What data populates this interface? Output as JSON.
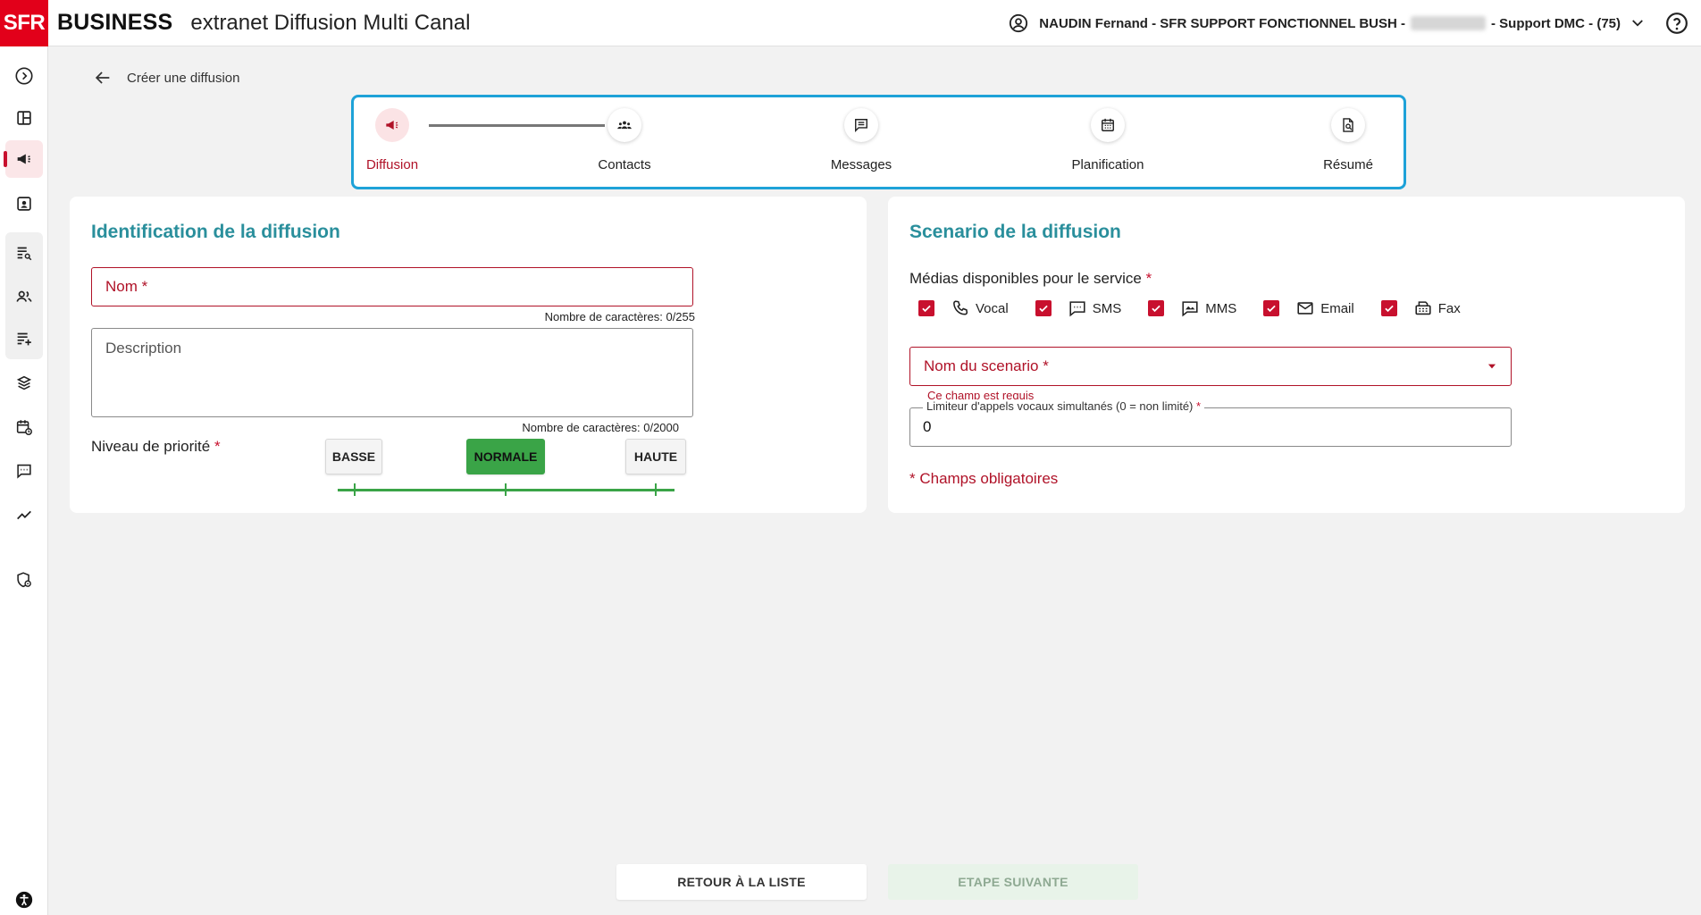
{
  "header": {
    "logo_sfr": "SFR",
    "logo_business": "BUSINESS",
    "app_title": "extranet Diffusion Multi Canal",
    "user_name": "NAUDIN Fernand - SFR SUPPORT FONCTIONNEL BUSH -",
    "user_suffix": "- Support DMC - (75)"
  },
  "breadcrumb": {
    "title": "Créer une diffusion"
  },
  "stepper": {
    "steps": [
      {
        "label": "Diffusion",
        "icon": "megaphone-icon",
        "active": true
      },
      {
        "label": "Contacts",
        "icon": "group-icon"
      },
      {
        "label": "Messages",
        "icon": "message-icon"
      },
      {
        "label": "Planification",
        "icon": "calendar-icon"
      },
      {
        "label": "Résumé",
        "icon": "document-search-icon"
      }
    ]
  },
  "identification": {
    "title": "Identification de la diffusion",
    "nom_placeholder": "Nom",
    "nom_counter": "Nombre de caractères: 0/255",
    "description_placeholder": "Description",
    "description_counter": "Nombre de caractères: 0/2000",
    "priority_label": "Niveau de priorité",
    "priority_options": [
      "BASSE",
      "NORMALE",
      "HAUTE"
    ],
    "priority_selected": "NORMALE"
  },
  "scenario": {
    "title": "Scenario de la diffusion",
    "media_label": "Médias disponibles pour le service",
    "media": [
      {
        "label": "Vocal",
        "icon": "phone-icon",
        "checked": true
      },
      {
        "label": "SMS",
        "icon": "sms-icon",
        "checked": true
      },
      {
        "label": "MMS",
        "icon": "mms-icon",
        "checked": true
      },
      {
        "label": "Email",
        "icon": "email-icon",
        "checked": true
      },
      {
        "label": "Fax",
        "icon": "fax-icon",
        "checked": true
      }
    ],
    "scenario_placeholder": "Nom du scenario",
    "scenario_error": "Ce champ est requis",
    "limit_label": "Limiteur d'appels vocaux simultanés (0 = non limité)",
    "limit_value": "0",
    "required_note": "* Champs obligatoires"
  },
  "footer": {
    "back_label": "RETOUR À LA LISTE",
    "next_label": "ETAPE SUIVANTE"
  },
  "colors": {
    "brand_red": "#e2001a",
    "title_teal": "#2a8f9c",
    "stepper_border": "#1ea2d8",
    "priority_green": "#3aa447"
  }
}
